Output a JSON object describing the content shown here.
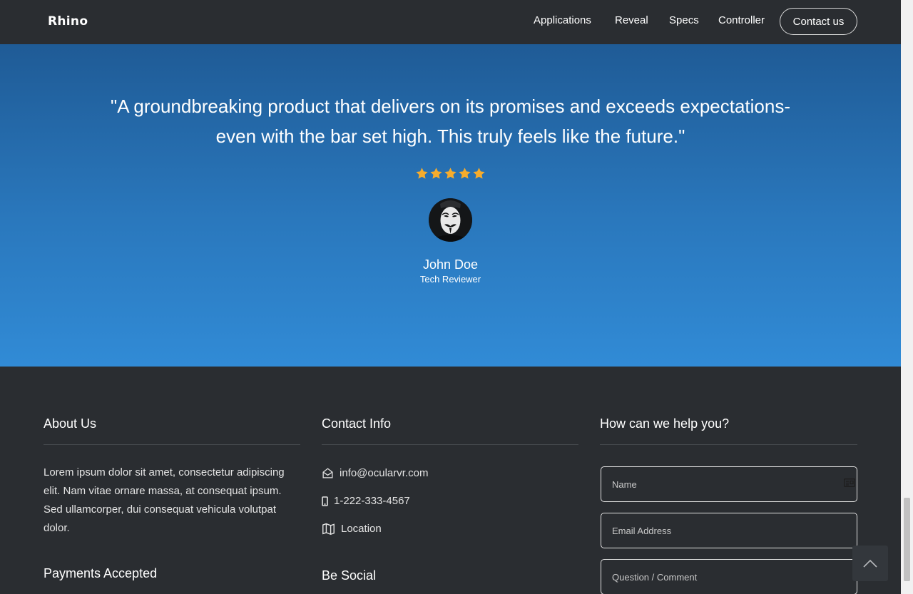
{
  "nav": {
    "logo": "Rhino",
    "items": [
      "Applications",
      "Reveal",
      "Specs",
      "Controller"
    ],
    "contact_label": "Contact us"
  },
  "testimonial": {
    "quote_line1": "\"A groundbreaking product that delivers on its promises and exceeds expectations-",
    "quote_line2": "even with the bar set high. This truly feels like the future.\"",
    "rating": 5,
    "star_color": "#f6ac2c",
    "name": "John Doe",
    "role": "Tech Reviewer"
  },
  "footer": {
    "about": {
      "heading": "About Us",
      "text": "Lorem ipsum dolor sit amet, consectetur adipiscing elit. Nam vitae ornare massa, at consequat ipsum. Sed ullamcorper, dui consequat vehicula volutpat dolor.",
      "payments_heading": "Payments Accepted"
    },
    "contact": {
      "heading": "Contact Info",
      "email": "info@ocularvr.com",
      "phone": "1-222-333-4567",
      "location": "Location",
      "social_heading": "Be Social"
    },
    "form": {
      "heading": "How can we help you?",
      "name_placeholder": "Name",
      "email_placeholder": "Email Address",
      "question_placeholder": "Question / Comment"
    }
  },
  "colors": {
    "dark_bg": "#2a2d31",
    "hero_top": "#1f5b96",
    "hero_bottom": "#318bd6"
  },
  "icons": {
    "email": "envelope-open-icon",
    "phone": "mobile-phone-icon",
    "location": "map-icon",
    "back_to_top": "chevron-up-icon",
    "name_field": "contact-card-icon"
  }
}
